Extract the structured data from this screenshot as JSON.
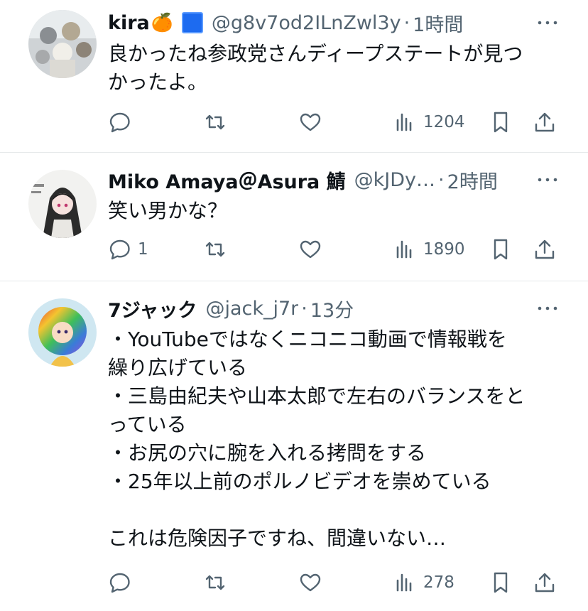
{
  "tweets": [
    {
      "name": "kira",
      "emoji": "🍊",
      "handle": "@g8v7od2ILnZwl3y",
      "time": "1時間",
      "lines": [
        "良かったね参政党さんディープステートが見つ",
        "かったよ。"
      ],
      "replies": "",
      "views": "1204"
    },
    {
      "name": "Miko Amaya＠Asura 鯖",
      "handle": "@kJDy…",
      "time": "2時間",
      "lines": [
        "笑い男かな？"
      ],
      "replies": "1",
      "views": "1890"
    },
    {
      "name": "7ジャック",
      "handle": "@jack_j7r",
      "time": "13分",
      "lines": [
        "・YouTubeではなくニコニコ動画で情報戦を",
        "繰り広げている",
        "・三島由紀夫や山本太郎で左右のバランスをと",
        "っている",
        "・お尻の穴に腕を入れる拷問をする",
        "・25年以上前のポルノビデオを崇めている",
        "",
        "これは危険因子ですね、間違いない…"
      ],
      "replies": "",
      "views": "278"
    }
  ],
  "sep": "·",
  "icons": {
    "reply": "reply-icon",
    "repost": "repost-icon",
    "like": "heart-icon",
    "views": "views-icon",
    "bookmark": "bookmark-icon",
    "share": "share-icon",
    "more": "more-icon"
  },
  "colors": {
    "secondary": "#536471",
    "primary": "#0f1419",
    "divider": "#e6e9ea"
  }
}
